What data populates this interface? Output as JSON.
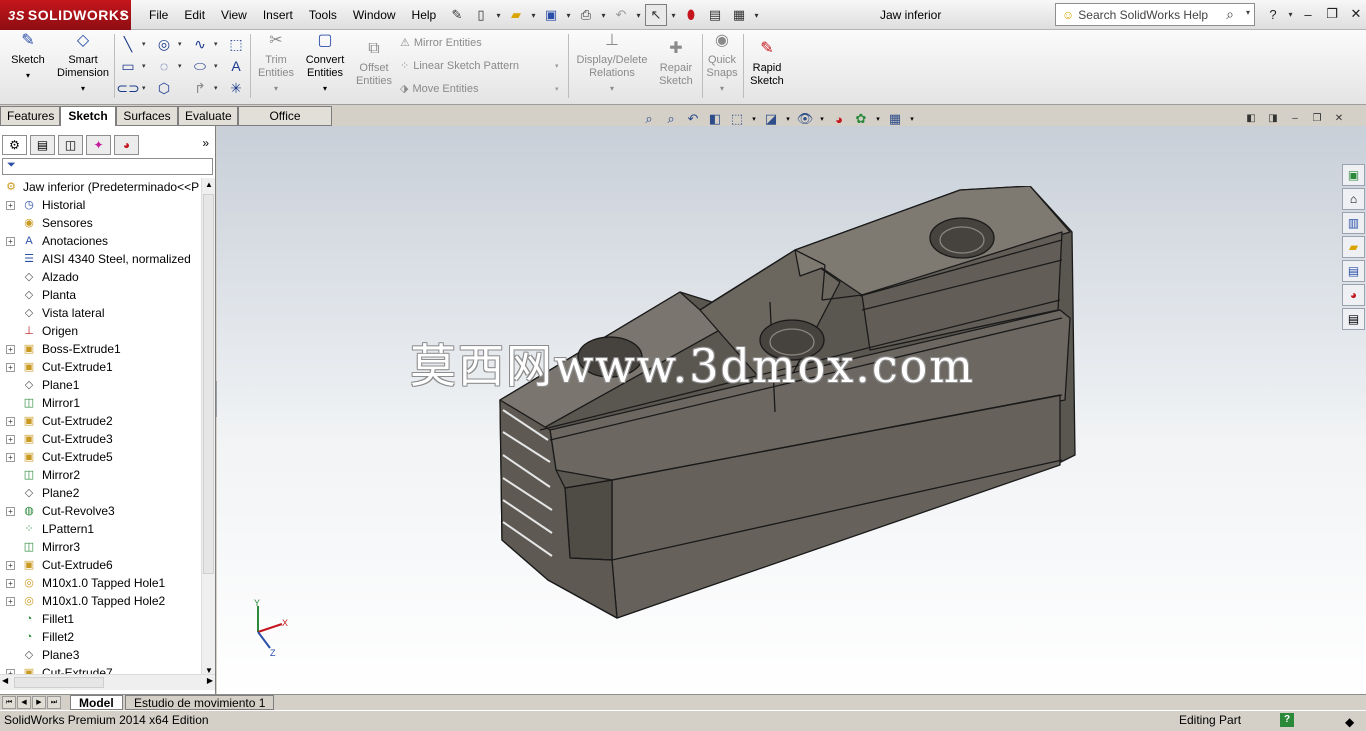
{
  "app": {
    "logo_prefix": "3S",
    "logo_text": "SOLIDWORKS",
    "document_title": "Jaw inferior"
  },
  "menu": [
    "File",
    "Edit",
    "View",
    "Insert",
    "Tools",
    "Window",
    "Help"
  ],
  "search": {
    "placeholder": "Search SolidWorks Help"
  },
  "ribbon": {
    "sketch": "Sketch",
    "smart_dimension": [
      "Smart",
      "Dimension"
    ],
    "trim_entities": [
      "Trim",
      "Entities"
    ],
    "convert_entities": [
      "Convert",
      "Entities"
    ],
    "offset_entities": [
      "Offset",
      "Entities"
    ],
    "mirror_entities": "Mirror Entities",
    "linear_sketch_pattern": "Linear Sketch Pattern",
    "move_entities": "Move Entities",
    "display_delete_relations": [
      "Display/Delete",
      "Relations"
    ],
    "repair_sketch": [
      "Repair",
      "Sketch"
    ],
    "quick_snaps": [
      "Quick",
      "Snaps"
    ],
    "rapid_sketch": [
      "Rapid",
      "Sketch"
    ]
  },
  "command_tabs": [
    {
      "label": "Features",
      "active": false
    },
    {
      "label": "Sketch",
      "active": true
    },
    {
      "label": "Surfaces",
      "active": false
    },
    {
      "label": "Evaluate",
      "active": false
    },
    {
      "label": "Office Products",
      "active": false
    }
  ],
  "feature_tree": {
    "root": "Jaw inferior  (Predeterminado<<P",
    "items": [
      {
        "label": "Historial",
        "icon": "history-icon",
        "expandable": true
      },
      {
        "label": "Sensores",
        "icon": "sensor-icon",
        "expandable": false
      },
      {
        "label": "Anotaciones",
        "icon": "annotation-icon",
        "expandable": true
      },
      {
        "label": "AISI 4340 Steel, normalized",
        "icon": "material-icon",
        "expandable": false
      },
      {
        "label": "Alzado",
        "icon": "plane-icon",
        "expandable": false
      },
      {
        "label": "Planta",
        "icon": "plane-icon",
        "expandable": false
      },
      {
        "label": "Vista lateral",
        "icon": "plane-icon",
        "expandable": false
      },
      {
        "label": "Origen",
        "icon": "origin-icon",
        "expandable": false
      },
      {
        "label": "Boss-Extrude1",
        "icon": "boss-extrude-icon",
        "expandable": true
      },
      {
        "label": "Cut-Extrude1",
        "icon": "cut-extrude-icon",
        "expandable": true
      },
      {
        "label": "Plane1",
        "icon": "plane-icon",
        "expandable": false
      },
      {
        "label": "Mirror1",
        "icon": "mirror-icon",
        "expandable": false
      },
      {
        "label": "Cut-Extrude2",
        "icon": "cut-extrude-icon",
        "expandable": true
      },
      {
        "label": "Cut-Extrude3",
        "icon": "cut-extrude-icon",
        "expandable": true
      },
      {
        "label": "Cut-Extrude5",
        "icon": "cut-extrude-icon",
        "expandable": true
      },
      {
        "label": "Mirror2",
        "icon": "mirror-icon",
        "expandable": false
      },
      {
        "label": "Plane2",
        "icon": "plane-icon",
        "expandable": false
      },
      {
        "label": "Cut-Revolve3",
        "icon": "cut-revolve-icon",
        "expandable": true
      },
      {
        "label": "LPattern1",
        "icon": "linear-pattern-icon",
        "expandable": false
      },
      {
        "label": "Mirror3",
        "icon": "mirror-icon",
        "expandable": false
      },
      {
        "label": "Cut-Extrude6",
        "icon": "cut-extrude-icon",
        "expandable": true
      },
      {
        "label": "M10x1.0 Tapped Hole1",
        "icon": "hole-icon",
        "expandable": true
      },
      {
        "label": "M10x1.0 Tapped Hole2",
        "icon": "hole-icon",
        "expandable": true
      },
      {
        "label": "Fillet1",
        "icon": "fillet-icon",
        "expandable": false
      },
      {
        "label": "Fillet2",
        "icon": "fillet-icon",
        "expandable": false
      },
      {
        "label": "Plane3",
        "icon": "plane-icon",
        "expandable": false
      },
      {
        "label": "Cut-Extrude7",
        "icon": "cut-extrude-icon",
        "expandable": true
      }
    ]
  },
  "watermark": "莫西网www.3dmox.com",
  "triad": {
    "x": "X",
    "y": "Y",
    "z": "Z"
  },
  "bottom_tabs": [
    {
      "label": "Model",
      "active": true
    },
    {
      "label": "Estudio de movimiento 1",
      "active": false
    }
  ],
  "status": {
    "left": "SolidWorks Premium 2014 x64 Edition",
    "right": "Editing Part",
    "help": "?"
  },
  "colors": {
    "brand": "#c4161c",
    "model_face": "#6e6a64",
    "viewport_top": "#c8cfd8"
  }
}
